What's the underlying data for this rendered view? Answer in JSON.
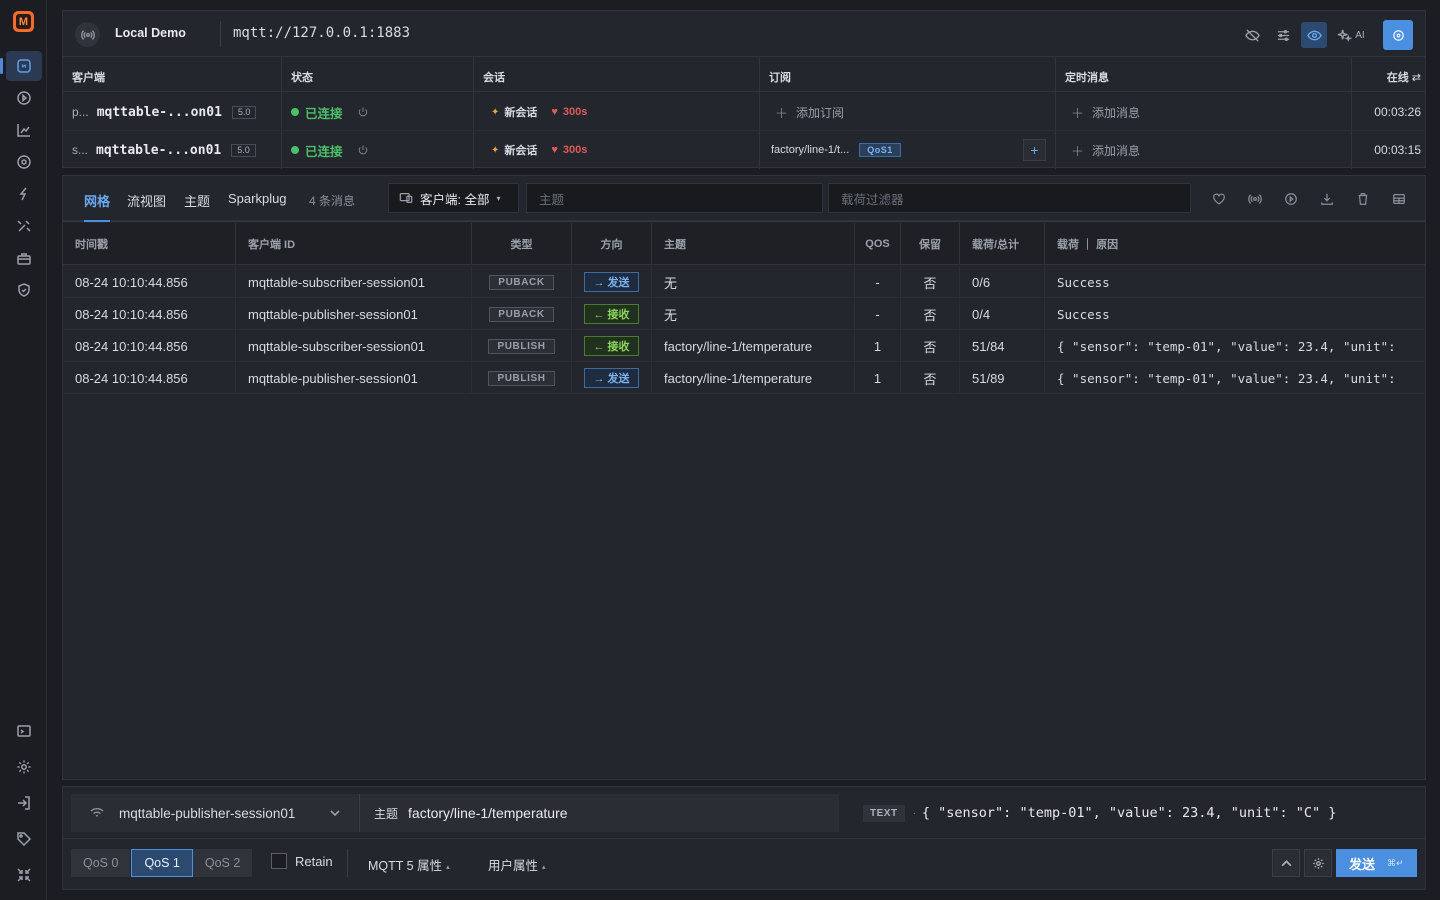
{
  "header": {
    "connection_name": "Local Demo",
    "broker_url": "mqtt://127.0.0.1:1883",
    "ai_label": "AI"
  },
  "clients_table": {
    "headers": {
      "client": "客户端",
      "status": "状态",
      "session": "会话",
      "subscriptions": "订阅",
      "scheduled": "定时消息",
      "online": "在线"
    },
    "rows": [
      {
        "prefix": "p...",
        "name": "mqttable-...on01",
        "version": "5.0",
        "status": "已连接",
        "session": "新会话",
        "expiry": "300s",
        "subscription": "添加订阅",
        "scheduled": "添加消息",
        "uptime": "00:03:26"
      },
      {
        "prefix": "s...",
        "name": "mqttable-...on01",
        "version": "5.0",
        "status": "已连接",
        "session": "新会话",
        "expiry": "300s",
        "subscription_topic": "factory/line-1/t...",
        "subscription_qos": "QoS1",
        "scheduled": "添加消息",
        "uptime": "00:03:15"
      }
    ]
  },
  "messages": {
    "tabs": [
      "网格",
      "流视图",
      "主题",
      "Sparkplug"
    ],
    "count_label": "4 条消息",
    "client_filter": "客户端: 全部",
    "topic_placeholder": "主题",
    "payload_placeholder": "载荷过滤器",
    "columns": {
      "timestamp": "时间戳",
      "client_id": "客户端 ID",
      "type": "类型",
      "direction": "方向",
      "topic": "主题",
      "qos": "QOS",
      "retain": "保留",
      "size": "载荷/总计",
      "payload": "载荷 ｜ 原因"
    },
    "rows": [
      {
        "timestamp": "08-24 10:10:44.856",
        "client_id": "mqttable-subscriber-session01",
        "type": "PUBACK",
        "direction": "→ 发送",
        "dir_kind": "send",
        "topic": "无",
        "qos": "-",
        "retain": "否",
        "size": "0/6",
        "payload": "Success"
      },
      {
        "timestamp": "08-24 10:10:44.856",
        "client_id": "mqttable-publisher-session01",
        "type": "PUBACK",
        "direction": "← 接收",
        "dir_kind": "recv",
        "topic": "无",
        "qos": "-",
        "retain": "否",
        "size": "0/4",
        "payload": "Success"
      },
      {
        "timestamp": "08-24 10:10:44.856",
        "client_id": "mqttable-subscriber-session01",
        "type": "PUBLISH",
        "direction": "← 接收",
        "dir_kind": "recv",
        "topic": "factory/line-1/temperature",
        "qos": "1",
        "retain": "否",
        "size": "51/84",
        "payload": "{ \"sensor\": \"temp-01\", \"value\": 23.4, \"unit\":"
      },
      {
        "timestamp": "08-24 10:10:44.856",
        "client_id": "mqttable-publisher-session01",
        "type": "PUBLISH",
        "direction": "→ 发送",
        "dir_kind": "send",
        "topic": "factory/line-1/temperature",
        "qos": "1",
        "retain": "否",
        "size": "51/89",
        "payload": "{ \"sensor\": \"temp-01\", \"value\": 23.4, \"unit\":"
      }
    ]
  },
  "composer": {
    "client": "mqttable-publisher-session01",
    "topic_label": "主题",
    "topic": "factory/line-1/temperature",
    "format": "TEXT",
    "payload": "{ \"sensor\": \"temp-01\", \"value\": 23.4, \"unit\": \"C\" }",
    "qos_options": [
      "QoS 0",
      "QoS 1",
      "QoS 2"
    ],
    "qos_selected": "QoS 1",
    "retain_label": "Retain",
    "mqtt5_props": "MQTT 5 属性",
    "user_props": "用户属性",
    "send_label": "发送",
    "send_shortcut": "⌘↵"
  },
  "colors": {
    "accent": "#4a8fe0",
    "connected": "#4cc06b",
    "recv": "#8ad65c",
    "logo": "#f56b2a"
  }
}
